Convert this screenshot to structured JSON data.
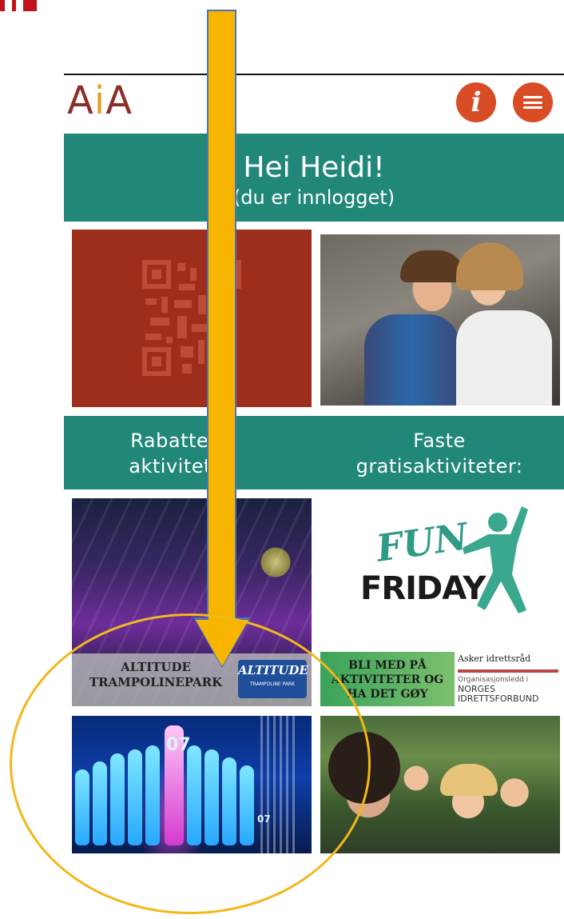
{
  "header": {
    "logo_prefix": "A",
    "logo_mid": "i",
    "logo_suffix": "A",
    "info_icon_glyph": "i"
  },
  "greeting": {
    "title": "Hei Heidi!",
    "subtitle": "(du er innlogget)"
  },
  "sections": {
    "left_label_line1": "Rabatterte",
    "left_label_line2": "aktiviteter:",
    "right_label_line1": "Faste",
    "right_label_line2": "gratisaktiviteter:"
  },
  "tiles": {
    "trampoline_text_line1": "ALTITUDE",
    "trampoline_text_line2": "TRAMPOLINEPARK",
    "trampoline_logo_main": "ALTITUDE",
    "trampoline_logo_sub": "TRAMPOLINE PARK",
    "fun_word": "FUN",
    "friday_word": "FRIDAY",
    "idrett_line1": "BLI MED PÅ",
    "idrett_line2": "AKTIVITETER OG",
    "idrett_line3": "HA DET GØY",
    "org_title": "Asker idrettsråd",
    "org_sub": "Organisasjonsledd i",
    "org_name_line1": "NORGES",
    "org_name_line2": "IDRETTSFORBUND",
    "bowling_number_large": "07",
    "bowling_number_small": "07"
  },
  "colors": {
    "teal": "#218879",
    "logo_red": "#8b2f28",
    "logo_gold": "#e0a227",
    "button_orange": "#d94d26",
    "qr_red": "#9e2e1c",
    "arrow_yellow": "#f7b500",
    "ellipse_yellow": "#f3b71c"
  },
  "icons": {
    "info": "info-icon",
    "menu": "hamburger-menu-icon",
    "qr": "qr-code-icon"
  }
}
